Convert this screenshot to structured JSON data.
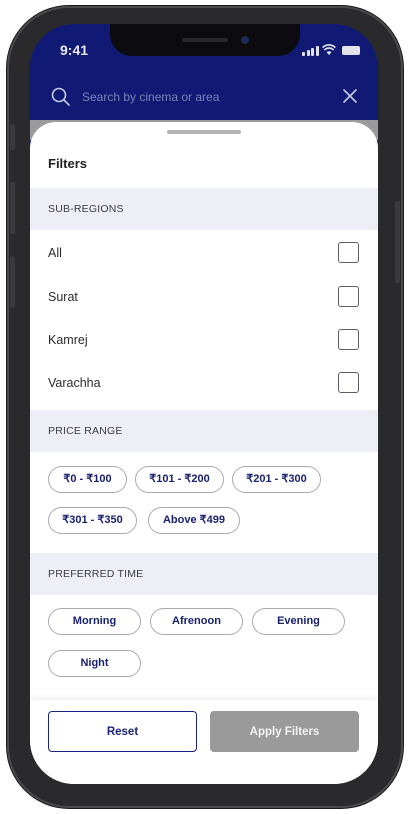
{
  "status_bar": {
    "time": "9:41"
  },
  "search": {
    "placeholder": "Search by cinema or area"
  },
  "sheet": {
    "title": "Filters",
    "sub_regions": {
      "heading": "SUB-REGIONS",
      "items": [
        {
          "label": "All",
          "checked": false
        },
        {
          "label": "Surat",
          "checked": false
        },
        {
          "label": "Kamrej",
          "checked": false
        },
        {
          "label": "Varachha",
          "checked": false
        }
      ]
    },
    "price_range": {
      "heading": "PRICE RANGE",
      "options": [
        "₹0 - ₹100",
        "₹101 - ₹200",
        "₹201 - ₹300",
        "₹301 - ₹350",
        "Above ₹499"
      ]
    },
    "preferred_time": {
      "heading": "PREFERRED TIME",
      "options": [
        "Morning",
        "Afrenoon",
        "Evening",
        "Night"
      ]
    },
    "footer": {
      "reset_label": "Reset",
      "apply_label": "Apply Filters"
    }
  },
  "colors": {
    "brand_navy": "#101a74",
    "chip_text": "#1a2170",
    "apply_disabled": "#9a9a9a",
    "section_bg": "#eeeef6"
  }
}
